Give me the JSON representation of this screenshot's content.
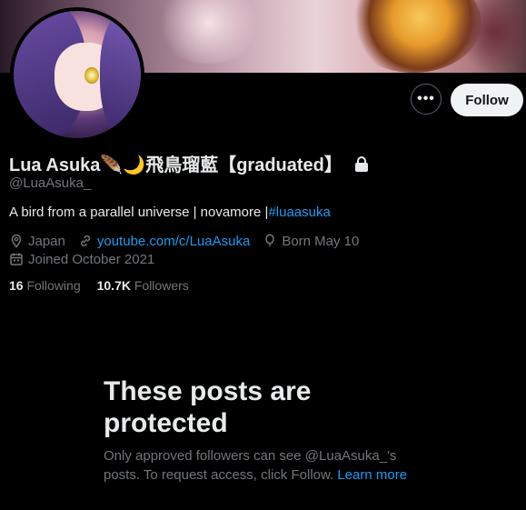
{
  "profile": {
    "display_name": "Lua Asuka🪶🌙飛鳥瑠藍【graduated】",
    "handle": "@LuaAsuka_",
    "bio_text": "A bird from a parallel universe | novamore |",
    "bio_hashtag": "#luaasuka",
    "location": "Japan",
    "website": "youtube.com/c/LuaAsuka",
    "birthday": "Born May 10",
    "joined": "Joined October 2021",
    "following_count": "16",
    "following_label": "Following",
    "followers_count": "10.7K",
    "followers_label": "Followers"
  },
  "actions": {
    "more_label": "•••",
    "follow_label": "Follow"
  },
  "protected": {
    "title": "These posts are protected",
    "body": "Only approved followers can see @LuaAsuka_'s posts. To request access, click Follow.",
    "learn_more": "Learn more"
  },
  "colors": {
    "accent": "#1d9bf0",
    "text_primary": "#e7e9ea",
    "text_secondary": "#71767b",
    "background": "#000000"
  },
  "icons": {
    "lock": "lock-icon",
    "location": "location-pin-icon",
    "link": "link-icon",
    "birthday": "balloon-icon",
    "calendar": "calendar-icon"
  }
}
